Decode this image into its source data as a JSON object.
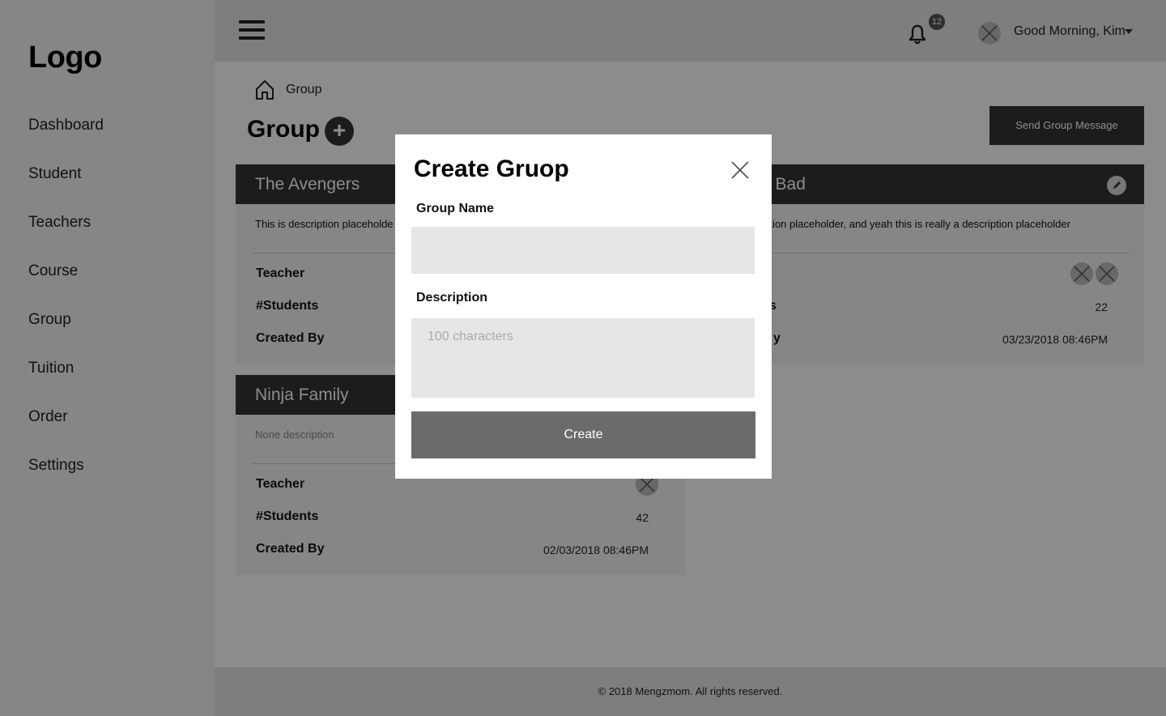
{
  "sidebar": {
    "logo": "Logo",
    "items": [
      {
        "label": "Dashboard"
      },
      {
        "label": "Student"
      },
      {
        "label": "Teachers"
      },
      {
        "label": "Course"
      },
      {
        "label": "Group"
      },
      {
        "label": "Tuition"
      },
      {
        "label": "Order"
      },
      {
        "label": "Settings"
      }
    ]
  },
  "topbar": {
    "notification_count": "12",
    "greeting": "Good Morning, Kim"
  },
  "breadcrumb": {
    "current": "Group"
  },
  "page": {
    "title": "Group",
    "add_label": "+",
    "send_message_label": "Send Group Message"
  },
  "groups": [
    {
      "name": "The Avengers",
      "description": "This is description placeholde",
      "teacher_label": "Teacher",
      "students_label": "#Students",
      "created_label": "Created By"
    },
    {
      "name": "g Bad",
      "description": "ription placeholder, and yeah this is really a description placeholder",
      "students_label": "s",
      "created_label": "y",
      "students": "22",
      "created": "03/23/2018  08:46PM"
    },
    {
      "name": "Ninja Family",
      "description": "None description",
      "teacher_label": "Teacher",
      "students_label": "#Students",
      "created_label": "Created By",
      "students": "42",
      "created": "02/03/2018  08:46PM"
    }
  ],
  "modal": {
    "title": "Create Gruop",
    "group_name_label": "Group Name",
    "group_name_value": "",
    "description_label": "Description",
    "description_placeholder": "100 characters",
    "create_label": "Create"
  },
  "footer": {
    "text": "© 2018 Mengzmom. All rights reserved."
  },
  "colors": {
    "header_dark": "#333333",
    "sidebar_bg": "#f5f5f5",
    "topbar_bg": "#e6e6e6",
    "button_gray": "#6b6b6b"
  }
}
